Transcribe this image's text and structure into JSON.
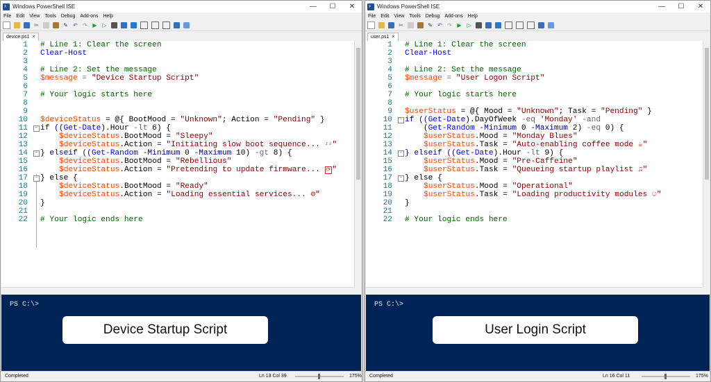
{
  "window_title": "Windows PowerShell ISE",
  "menu": [
    "File",
    "Edit",
    "View",
    "Tools",
    "Debug",
    "Add-ons",
    "Help"
  ],
  "window_controls": {
    "min": "—",
    "max": "☐",
    "close": "✕"
  },
  "left": {
    "tab": "device.ps1",
    "tab_close": "×",
    "line_numbers": [
      "1",
      "2",
      "3",
      "4",
      "5",
      "6",
      "7",
      "8",
      "9",
      "10",
      "11",
      "12",
      "13",
      "14",
      "15",
      "16",
      "17",
      "18",
      "19",
      "20",
      "21",
      "22"
    ],
    "prompt": "PS C:\\>",
    "label": "Device Startup Script",
    "status": "Completed",
    "position": "Ln 13  Col 39",
    "zoom": "175%"
  },
  "right": {
    "tab": "user.ps1",
    "tab_close": "×",
    "line_numbers": [
      "1",
      "2",
      "3",
      "4",
      "5",
      "6",
      "7",
      "8",
      "9",
      "10",
      "11",
      "12",
      "13",
      "14",
      "15",
      "16",
      "17",
      "18",
      "19",
      "20",
      "21",
      "22"
    ],
    "prompt": "PS C:\\>",
    "label": "User Login Script",
    "status": "Completed",
    "position": "Ln 16  Col 11",
    "zoom": "175%"
  },
  "code_left": {
    "l1": "# Line 1: Clear the screen",
    "l2": "Clear-Host",
    "l4": "# Line 2: Set the message",
    "l5v": "$message",
    "l5s": "\"Device Startup Script\"",
    "l7": "# Your logic starts here",
    "l10v": "$deviceStatus",
    "l10a": " = @{ BootMood = ",
    "l10s1": "\"Unknown\"",
    "l10b": "; Action = ",
    "l10s2": "\"Pending\"",
    "l10c": " }",
    "l11a": "if ((",
    "l11k": "Get-Date",
    "l11b": ").Hour ",
    "l11o": "-lt",
    "l11c": " 6) {",
    "l12v": "$deviceStatus",
    "l12a": ".BootMood = ",
    "l12s": "\"Sleepy\"",
    "l13v": "$deviceStatus",
    "l13a": ".Action = ",
    "l13s": "\"Initiating slow boot sequence... \u0003\u0003\"",
    "l14a": "} elseif ((",
    "l14k": "Get-Random",
    "l14p1": " -Minimum",
    "l14n1": " 0",
    "l14p2": " -Maximum",
    "l14n2": " 10) ",
    "l14o": "-gt",
    "l14c": " 8) {",
    "l15v": "$deviceStatus",
    "l15a": ".BootMood = ",
    "l15s": "\"Rebellious\"",
    "l16v": "$deviceStatus",
    "l16a": ".Action = ",
    "l16s": "\"Pretending to update firmware... ",
    "l16e": "\"",
    "l17": "} else {",
    "l18v": "$deviceStatus",
    "l18a": ".BootMood = ",
    "l18s": "\"Ready\"",
    "l19v": "$deviceStatus",
    "l19a": ".Action = ",
    "l19s": "\"Loading essential services... ",
    "l19e": "\"",
    "l20": "}",
    "l22": "# Your logic ends here",
    "emoji_zz": "ᶻᶻ",
    "emoji_box": "⟳",
    "emoji_gear": "⚙"
  },
  "code_right": {
    "l1": "# Line 1: Clear the screen",
    "l2": "Clear-Host",
    "l4": "# Line 2: Set the message",
    "l5v": "$message",
    "l5s": "\"User Logon Script\"",
    "l7": "# Your logic starts here",
    "l9v": "$userStatus",
    "l9a": " = @{ Mood = ",
    "l9s1": "\"Unknown\"",
    "l9b": "; Task = ",
    "l9s2": "\"Pending\"",
    "l9c": " }",
    "l10a": "if ((",
    "l10k": "Get-Date",
    "l10b": ").DayOfWeek ",
    "l10o": "-eq",
    "l10s": " 'Monday'",
    "l10o2": " -and",
    "l11a": "    (",
    "l11k": "Get-Random",
    "l11p1": " -Minimum",
    "l11n1": " 0",
    "l11p2": " -Maximum",
    "l11n2": " 2) ",
    "l11o": "-eq",
    "l11c": " 0) {",
    "l12v": "$userStatus",
    "l12a": ".Mood = ",
    "l12s": "\"Monday Blues\"",
    "l13v": "$userStatus",
    "l13a": ".Task = ",
    "l13s": "\"Auto-enabling coffee mode ",
    "l13e": "\"",
    "l14a": "} elseif ((",
    "l14k": "Get-Date",
    "l14b": ").Hour ",
    "l14o": "-lt",
    "l14c": " 9) {",
    "l15v": "$userStatus",
    "l15a": ".Mood = ",
    "l15s": "\"Pre-Caffeine\"",
    "l16v": "$userStatus",
    "l16a": ".Task = ",
    "l16s": "\"Queueing startup playlist ",
    "l16e": "\"",
    "l17": "} else {",
    "l18v": "$userStatus",
    "l18a": ".Mood = ",
    "l18s": "\"Operational\"",
    "l19v": "$userStatus",
    "l19a": ".Task = ",
    "l19s": "\"Loading productivity modules ",
    "l19e": "\"",
    "l20": "}",
    "l22": "# Your logic ends here",
    "emoji_cup": "☕",
    "emoji_note": "♫",
    "emoji_face": "☺"
  }
}
